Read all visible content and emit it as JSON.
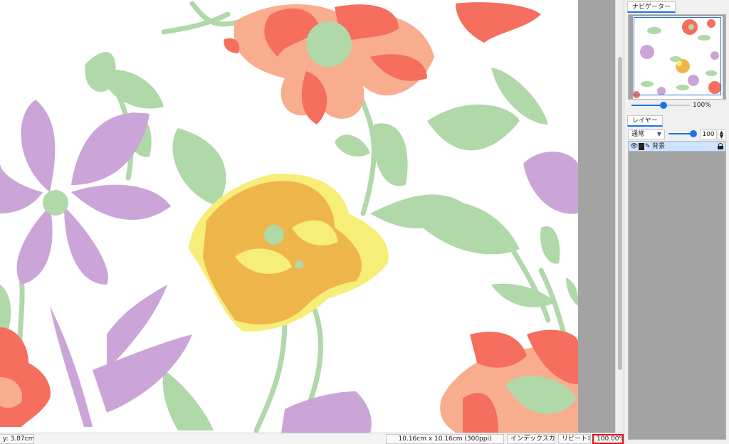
{
  "status_bar": {
    "coord_label": "y:",
    "coord_value": "3.87cm",
    "document_size": "10.16cm x 10.16cm (300ppi)",
    "index_color_button": "インデックスカラー",
    "repeat_button": "リピートオフ",
    "zoom": "100.00%"
  },
  "navigator": {
    "tab_label": "ナビゲーター",
    "zoom_label": "100%",
    "zoom_fraction": 0.55
  },
  "layers": {
    "tab_label": "レイヤー",
    "blend_mode": "通常",
    "opacity": "100",
    "opacity_fraction": 1.0,
    "items": [
      {
        "name": "背景",
        "visible": true,
        "locked": true
      }
    ]
  },
  "colors": {
    "accent": "#1a73e8",
    "highlight_border": "#e0121a",
    "leaf_green": "#b0d8a8",
    "lavender": "#cba5d8",
    "coral": "#f56e5e",
    "peach": "#f7ad8e",
    "amber": "#eeb64a",
    "lemon": "#f6ee78"
  }
}
